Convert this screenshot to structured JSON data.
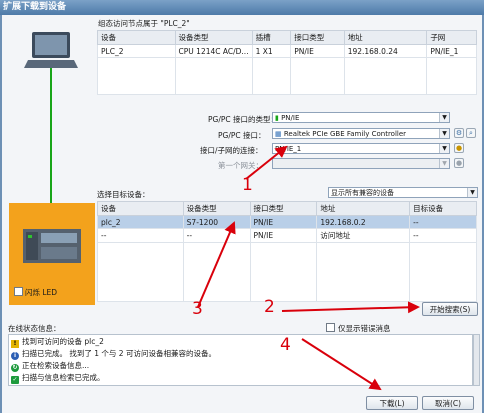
{
  "window": {
    "title": "扩展下载到设备"
  },
  "target_nodes": {
    "caption": "组态访问节点属于 \"PLC_2\"",
    "columns": [
      "设备",
      "设备类型",
      "插槽",
      "接口类型",
      "地址",
      "子网"
    ],
    "rows": [
      [
        "PLC_2",
        "CPU 1214C AC/D...",
        "1 X1",
        "PN/IE",
        "192.168.0.24",
        "PN/IE_1"
      ]
    ]
  },
  "pgpc": {
    "interface_type_label": "PG/PC 接口的类型：",
    "interface_type_value": "PN/IE",
    "interface_label": "PG/PC 接口：",
    "interface_value": "Realtek PCIe GBE Family Controller",
    "subnet_conn_label": "接口/子网的连接：",
    "subnet_conn_value": "PN/IE_1",
    "first_gateway_label": "第一个网关："
  },
  "select_target": {
    "label": "选择目标设备：",
    "filter_value": "显示所有兼容的设备",
    "columns": [
      "设备",
      "设备类型",
      "接口类型",
      "地址",
      "目标设备"
    ],
    "rows": [
      [
        "plc_2",
        "S7-1200",
        "PN/IE",
        "192.168.0.2",
        "--"
      ],
      [
        "--",
        "--",
        "PN/IE",
        "访问地址",
        "--"
      ]
    ]
  },
  "device_panel": {
    "flash_led_label": "闪烁 LED"
  },
  "buttons": {
    "start_search": "开始搜索(S)",
    "load": "下载(L)",
    "cancel": "取消(C)"
  },
  "status": {
    "label": "在线状态信息：",
    "only_errors_label": "仅显示错误消息",
    "messages": [
      {
        "icon": "warning",
        "text": "找到可访问的设备 plc_2"
      },
      {
        "icon": "info",
        "text": "扫描已完成。 找到了 1 个与 2 可访问设备相兼容的设备。"
      },
      {
        "icon": "progress",
        "text": "正在检索设备信息..."
      },
      {
        "icon": "success",
        "text": "扫描与信息检索已完成。"
      }
    ]
  },
  "annotations": {
    "n1": "1",
    "n2": "2",
    "n3": "3",
    "n4": "4"
  },
  "colors": {
    "annotation_red": "#d9000b",
    "device_orange": "#f3a21c",
    "selection_blue": "#b9cfe8"
  }
}
